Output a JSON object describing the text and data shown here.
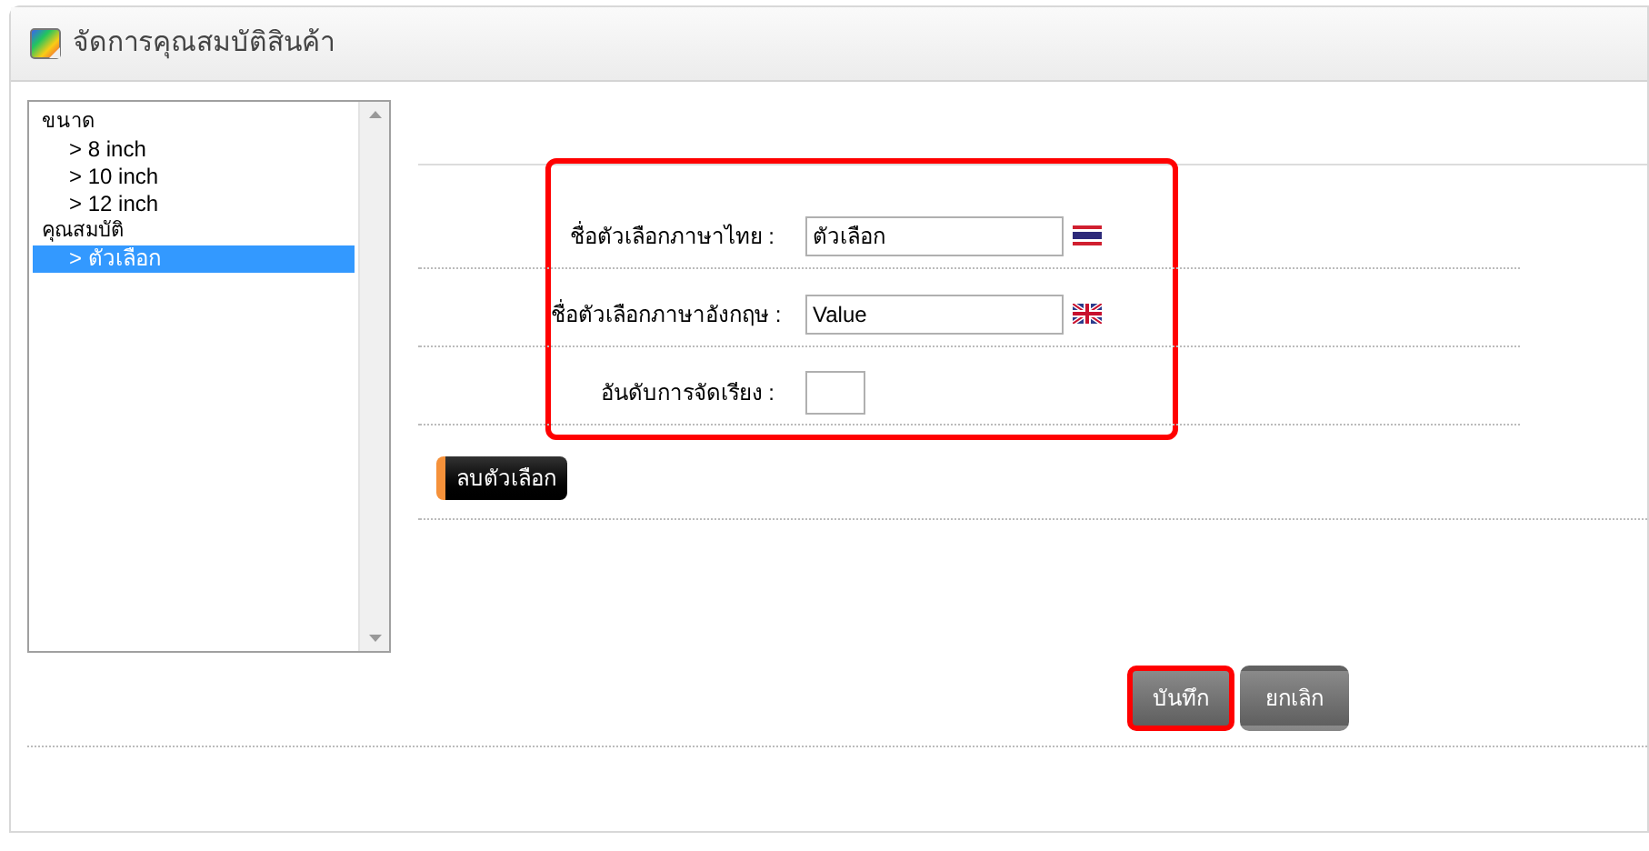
{
  "window": {
    "title": "จัดการคุณสมบัติสินค้า"
  },
  "tree": [
    {
      "label": "ขนาด",
      "selected": false,
      "children": [
        {
          "label": "> 8 inch",
          "selected": false
        },
        {
          "label": "> 10 inch",
          "selected": false
        },
        {
          "label": "> 12 inch",
          "selected": false
        }
      ]
    },
    {
      "label": "คุณสมบัติ",
      "selected": false,
      "children": [
        {
          "label": "> ตัวเลือก",
          "selected": true
        }
      ]
    }
  ],
  "form": {
    "highlighted": true,
    "fields": [
      {
        "label": "ชื่อตัวเลือกภาษาไทย :",
        "value": "ตัวเลือก",
        "kind": "thai"
      },
      {
        "label": "ชื่อตัวเลือกภาษาอังกฤษ :",
        "value": "Value",
        "kind": "english"
      },
      {
        "label": "อันดับการจัดเรียง :",
        "kind": "short"
      }
    ]
  },
  "delete_button": "ลบตัวเลือก",
  "buttons": [
    {
      "label": "บันทึก",
      "highlighted": true
    },
    {
      "label": "ยกเลิก",
      "highlighted": false
    }
  ]
}
